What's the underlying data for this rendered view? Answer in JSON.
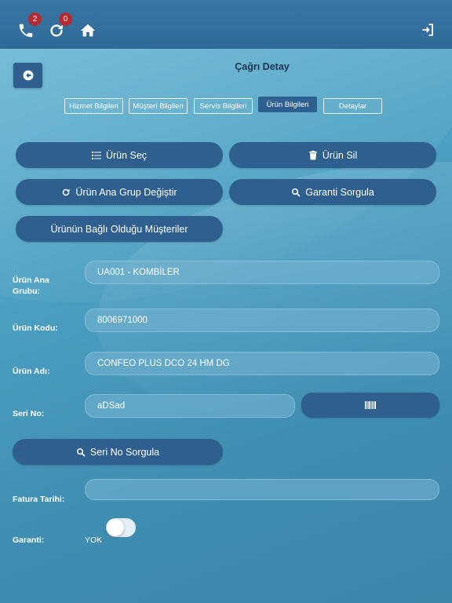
{
  "topbar": {
    "calls_badge": "2",
    "refresh_badge": "0"
  },
  "header": {
    "title": "Çağrı Detay"
  },
  "tabs": [
    {
      "label": "Hizmet Bilgileri",
      "active": false
    },
    {
      "label": "Müşteri Bilgileri",
      "active": false
    },
    {
      "label": "Servis Bilgileri",
      "active": false
    },
    {
      "label": "Ürün Bilgileri",
      "active": true
    },
    {
      "label": "Detaylar",
      "active": false
    }
  ],
  "actions": {
    "select_product": "Ürün Seç",
    "delete_product": "Ürün Sil",
    "change_main_group": "Ürün Ana Grup Değiştir",
    "warranty_query": "Garanti Sorgula",
    "linked_customers": "Ürünün Bağlı Olduğu Müşteriler",
    "serial_query": "Seri No Sorgula"
  },
  "form": {
    "main_group_label": "Ürün Ana Grubu:",
    "main_group_value": "UA001 - KOMBİLER",
    "code_label": "Ürün Kodu:",
    "code_value": "8006971000",
    "name_label": "Ürün Adı:",
    "name_value": "CONFEO PLUS DCO 24 HM DG",
    "serial_label": "Seri No:",
    "serial_value": "aDSad",
    "invoice_label": "Fatura Tarihi:",
    "invoice_value": "",
    "warranty_label": "Garanti:",
    "warranty_state": "YOK"
  },
  "colors": {
    "topbar": "#2f6a98",
    "button": "#2e5f8e",
    "badge": "#b52b32",
    "title": "#1c3550"
  }
}
